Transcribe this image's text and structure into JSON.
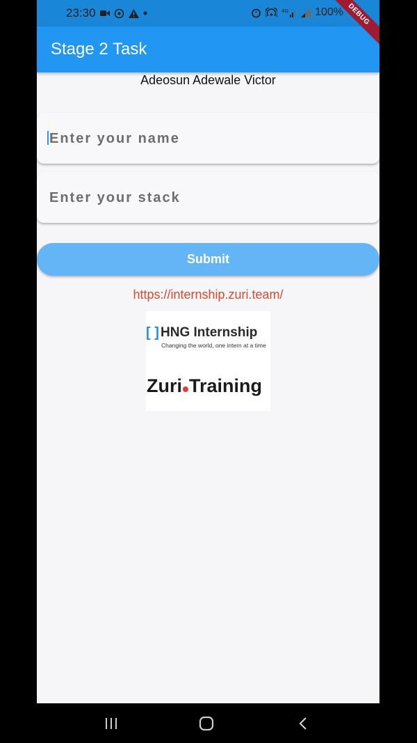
{
  "status_bar": {
    "time": "23:30",
    "battery": "100%",
    "icons": [
      "video-camera-icon",
      "whatsapp-icon",
      "warning-icon",
      "dot-icon",
      "alarm-icon",
      "hotspot-icon",
      "4g-signal-icon",
      "signal-icon",
      "signal-icon"
    ]
  },
  "debug_banner": "DEBUG",
  "app_bar": {
    "title": "Stage 2 Task"
  },
  "author": "Adeosun Adewale Victor",
  "form": {
    "name_placeholder": "Enter your name",
    "stack_placeholder": "Enter your stack",
    "submit_label": "Submit"
  },
  "link": "https://internship.zuri.team/",
  "logos": {
    "hng_title": "HNG Internship",
    "hng_tagline": "Changing the world, one intern at a time",
    "zuri_left": "Zuri",
    "zuri_right": "Training"
  },
  "nav": {
    "icons": [
      "recent-apps-icon",
      "home-icon",
      "back-icon"
    ]
  },
  "colors": {
    "app_bar": "#2196f3",
    "status_bar": "#1a86d8",
    "button": "#64b5f6",
    "link": "#d84a2f"
  }
}
